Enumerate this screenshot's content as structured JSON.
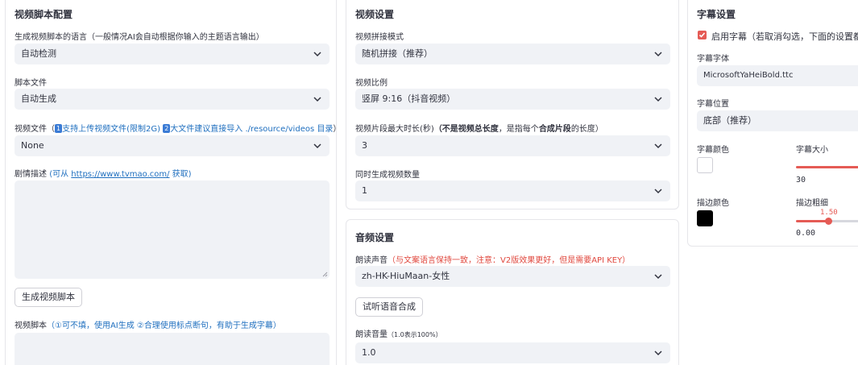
{
  "left_panel": {
    "title": "视频脚本配置",
    "language_label": "生成视频脚本的语言（一般情况AI会自动根据你输入的主题语言输出）",
    "language_value": "自动检测",
    "script_file_label": "脚本文件",
    "script_file_value": "自动生成",
    "video_file": {
      "label_prefix": "视频文件（",
      "badge1": "1",
      "part1": "支持上传视频文件(限制2G)",
      "badge2": "2",
      "part2": "大文件建议直接导入 ./resource/videos 目录",
      "suffix": "）",
      "value": "None"
    },
    "plot_desc": {
      "label": "剧情描述",
      "hint_prefix": "(可从",
      "link": "https://www.tvmao.com/",
      "hint_suffix": "获取)"
    },
    "generate_button": "生成视频脚本",
    "video_script": {
      "label": "视频脚本",
      "hint": "（①可不填，使用AI生成 ②合理使用标点断句，有助于生成字幕）"
    }
  },
  "video_settings": {
    "title": "视频设置",
    "concat_label": "视频拼接模式",
    "concat_value": "随机拼接（推荐）",
    "ratio_label": "视频比例",
    "ratio_value": "竖屏 9:16（抖音视频）",
    "clip_label_prefix": "视频片段最大时长(秒)",
    "clip_label_bold": "（不是视频总长度",
    "clip_label_mid": "，是指每个",
    "clip_label_bold2": "合成片段",
    "clip_label_suffix": "的长度）",
    "clip_value": "3",
    "count_label": "同时生成视频数量",
    "count_value": "1"
  },
  "audio_settings": {
    "title": "音频设置",
    "voice_label": "朗读声音",
    "voice_hint": "（与文案语言保持一致，注意：V2版效果更好，但是需要API KEY）",
    "voice_value": "zh-HK-HiuMaan-女性",
    "preview_button": "试听语音合成",
    "volume_label": "朗读音量",
    "volume_hint": "（1.0表示100%）",
    "volume_value": "1.0"
  },
  "subtitle_settings": {
    "title": "字幕设置",
    "enable_label": "启用字幕（若取消勾选，下面的设置都",
    "enabled": true,
    "font_label": "字幕字体",
    "font_value": "MicrosoftYaHeiBold.ttc",
    "position_label": "字幕位置",
    "position_value": "底部（推荐）",
    "color_label": "字幕颜色",
    "color_value": "#ffffff",
    "size_label": "字幕大小",
    "size_value": "30",
    "stroke_color_label": "描边颜色",
    "stroke_color_value": "#000000",
    "stroke_width_label": "描边粗细",
    "stroke_width_value": "1.50",
    "stroke_width_min": "0.00"
  },
  "colors": {
    "accent": "#e55b55",
    "link": "#1f6fbf",
    "input_bg": "#f0f2f6"
  }
}
